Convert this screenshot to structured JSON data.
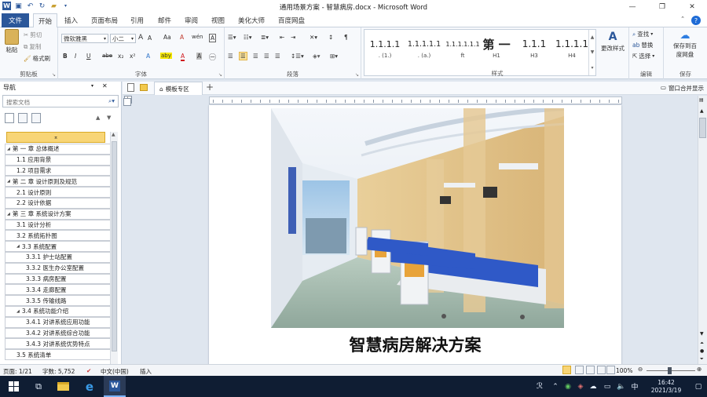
{
  "window": {
    "title": "通用场景方案 - 智慧病房.docx - Microsoft Word",
    "minimize_glyph": "—",
    "restore_glyph": "❐",
    "close_glyph": "✕"
  },
  "tabs": {
    "file": "文件",
    "items": [
      "开始",
      "插入",
      "页面布局",
      "引用",
      "邮件",
      "审阅",
      "视图",
      "美化大师",
      "百度网盘"
    ],
    "active": "开始"
  },
  "ribbon": {
    "clipboard": {
      "label": "剪贴板",
      "paste": "粘贴",
      "cut": "剪切",
      "copy": "复制",
      "format_painter": "格式刷"
    },
    "font": {
      "label": "字体",
      "font_name": "微软雅黑",
      "font_size": "小二",
      "grow": "A",
      "shrink": "A",
      "change_case": "Aa",
      "clear": "A",
      "phonetic": "wén",
      "border_char": "A",
      "bold": "B",
      "italic": "I",
      "underline": "U",
      "strike": "abe",
      "subscript": "x₂",
      "superscript": "x²",
      "effects": "A",
      "highlight": "aby",
      "color": "A",
      "shading": "A",
      "enclose": "㊀"
    },
    "paragraph": {
      "label": "段落"
    },
    "styles": {
      "label": "样式",
      "items": [
        {
          "sample": "1.1.1.1",
          "name": ". (1.)"
        },
        {
          "sample": "1.1.1.1.1",
          "name": ". (a.)"
        },
        {
          "sample": "1.1.1.1.1.1",
          "name": "ft"
        },
        {
          "sample": "第 一",
          "name": "H1"
        },
        {
          "sample": "1.1.1",
          "name": "H3"
        },
        {
          "sample": "1.1.1.1",
          "name": "H4"
        }
      ],
      "change_styles": "更改样式"
    },
    "editing": {
      "label": "编辑",
      "find": "查找",
      "replace": "替换",
      "select": "选择"
    },
    "save": {
      "label": "保存",
      "save_to_cloud_line1": "保存到百",
      "save_to_cloud_line2": "度网盘"
    }
  },
  "nav": {
    "title": "导航",
    "search_placeholder": "搜索文档",
    "nodes": [
      {
        "text": "第 一 章 总体概述",
        "level": 0,
        "expander": "◢"
      },
      {
        "text": "1.1 应用背景",
        "level": 1
      },
      {
        "text": "1.2 项目需求",
        "level": 1
      },
      {
        "text": "第 二 章 设计原则及规范",
        "level": 0,
        "expander": "◢"
      },
      {
        "text": "2.1 设计原则",
        "level": 1
      },
      {
        "text": "2.2 设计依据",
        "level": 1
      },
      {
        "text": "第 三 章 系统设计方案",
        "level": 0,
        "expander": "◢"
      },
      {
        "text": "3.1 设计分析",
        "level": 1
      },
      {
        "text": "3.2 系统拓扑图",
        "level": 1
      },
      {
        "text": "3.3 系统配置",
        "level": 1,
        "expander": "◢"
      },
      {
        "text": "3.3.1 护士站配置",
        "level": 2
      },
      {
        "text": "3.3.2 医生办公室配置",
        "level": 2
      },
      {
        "text": "3.3.3 病房配置",
        "level": 2
      },
      {
        "text": "3.3.4 走廊配置",
        "level": 2
      },
      {
        "text": "3.3.5 传输线路",
        "level": 2
      },
      {
        "text": "3.4 系统功能介绍",
        "level": 1,
        "expander": "◢"
      },
      {
        "text": "3.4.1 对讲系统应用功能",
        "level": 2
      },
      {
        "text": "3.4.2 对讲系统综合功能",
        "level": 2
      },
      {
        "text": "3.4.3 对讲系统优势特点",
        "level": 2
      },
      {
        "text": "3.5 系统清单",
        "level": 1
      }
    ]
  },
  "doc_tabs": {
    "template": "模板专区",
    "add": "+",
    "window_merge": "窗口合并显示"
  },
  "document": {
    "heading": "智慧病房解决方案"
  },
  "status": {
    "page": "页面: 1/21",
    "words": "字数: 5,752",
    "language": "中文(中国)",
    "mode": "插入",
    "zoom": "100%"
  },
  "taskbar": {
    "time": "16:42",
    "date": "2021/3/19",
    "ime": "中"
  }
}
